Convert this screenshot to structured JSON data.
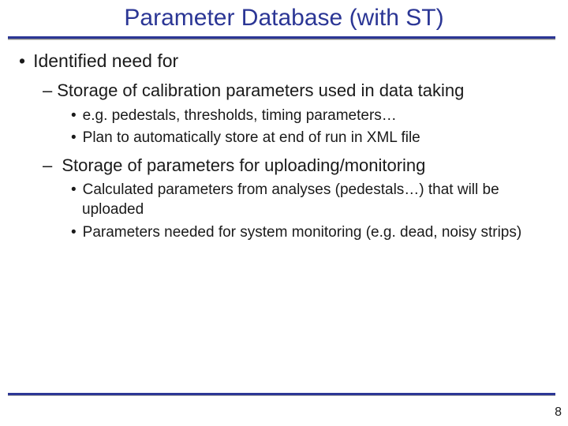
{
  "title": "Parameter Database (with ST)",
  "lvl1": "Identified need for",
  "sec1": {
    "head": "Storage of calibration parameters used in data taking",
    "b1": "e.g. pedestals, thresholds, timing parameters…",
    "b2": "Plan to automatically store at end of run in XML file"
  },
  "sec2": {
    "head": " Storage of parameters for uploading/monitoring",
    "b1": "Calculated parameters from analyses (pedestals…) that will be uploaded",
    "b2": "Parameters needed for system monitoring (e.g. dead, noisy strips)"
  },
  "page": "8"
}
